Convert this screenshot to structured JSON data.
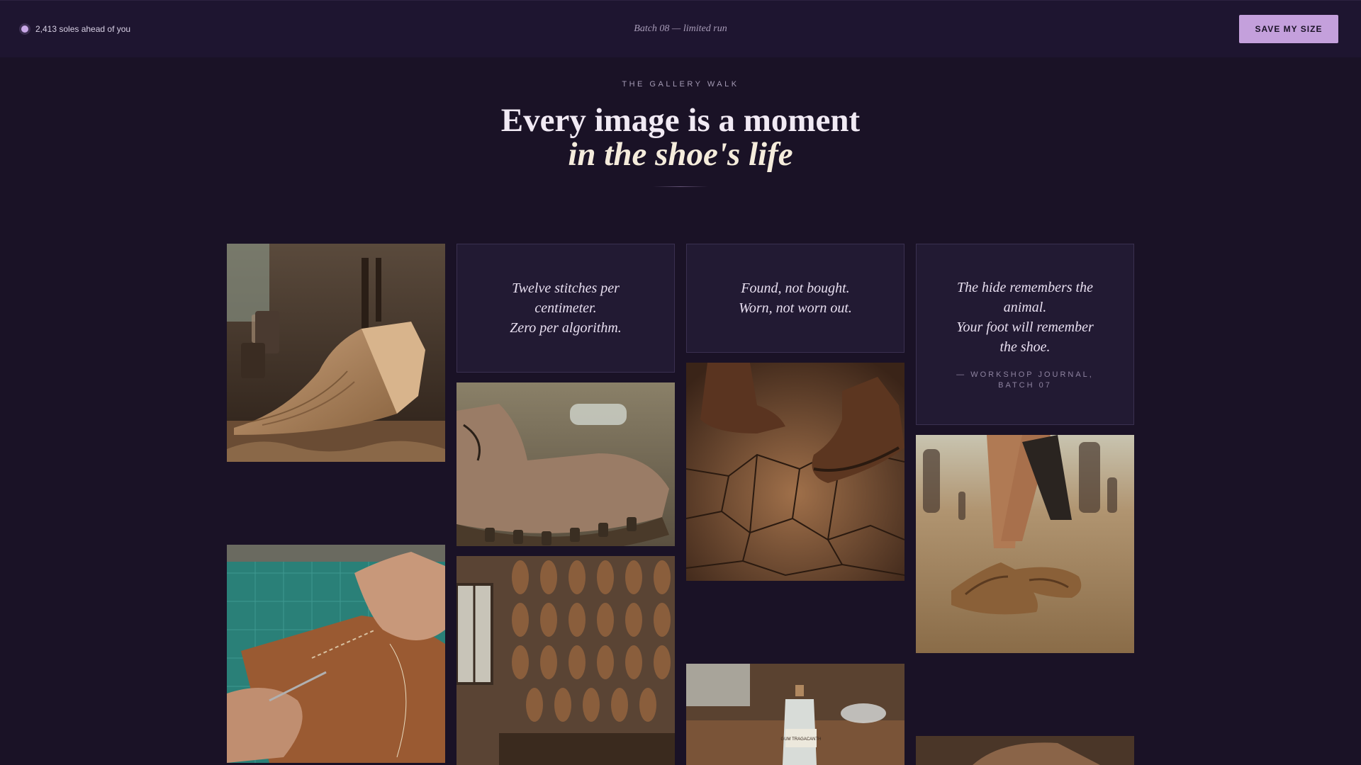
{
  "topbar": {
    "queue_text": "2,413 soles ahead of you",
    "batch_text": "Batch 08 — limited run",
    "save_label": "SAVE MY SIZE"
  },
  "hero": {
    "eyebrow": "THE GALLERY WALK",
    "headline_line1": "Every image is a moment",
    "headline_line2": "in the shoe's life"
  },
  "gallery": {
    "quote1": "Twelve stitches per\ncentimeter.\nZero per algorithm.",
    "quote2": "Found, not bought.\nWorn, not worn out.",
    "quote3": "The hide remembers the\nanimal.\nYour foot will remember\nthe shoe.",
    "quote3_cite": "— WORKSHOP JOURNAL,\nBATCH 07",
    "bottle_label": "GUM TRAGACANTH"
  },
  "colors": {
    "background": "#1a1226",
    "accent": "#c4a0dc",
    "card": "#221a33"
  }
}
